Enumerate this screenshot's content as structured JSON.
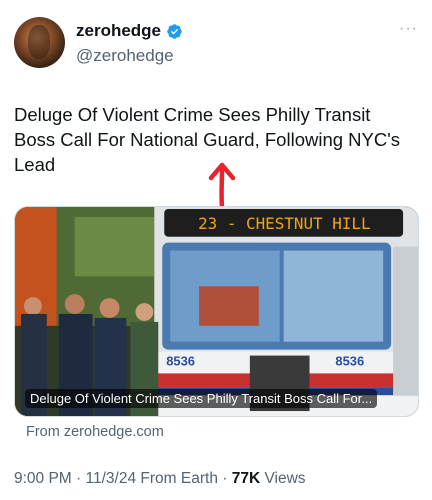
{
  "author": {
    "display_name": "zerohedge",
    "handle": "@zerohedge",
    "verified": true
  },
  "more_label": "···",
  "tweet": {
    "text": "Deluge Of Violent Crime Sees Philly Transit Boss Call For National Guard, Following NYC's Lead"
  },
  "card": {
    "headline": "Deluge Of Violent Crime Sees Philly Transit Boss Call For...",
    "bus_sign": "23 - CHESTNUT HILL",
    "bus_number": "8536",
    "source": "From zerohedge.com"
  },
  "meta": {
    "time": "9:00 PM",
    "date": "11/3/24",
    "client": "From Earth",
    "views_count": "77K",
    "views_label": "Views",
    "separator": "·"
  },
  "colors": {
    "verified_blue": "#1d9bf0",
    "annotation_red": "#e8232d",
    "secondary_text": "#536471"
  }
}
